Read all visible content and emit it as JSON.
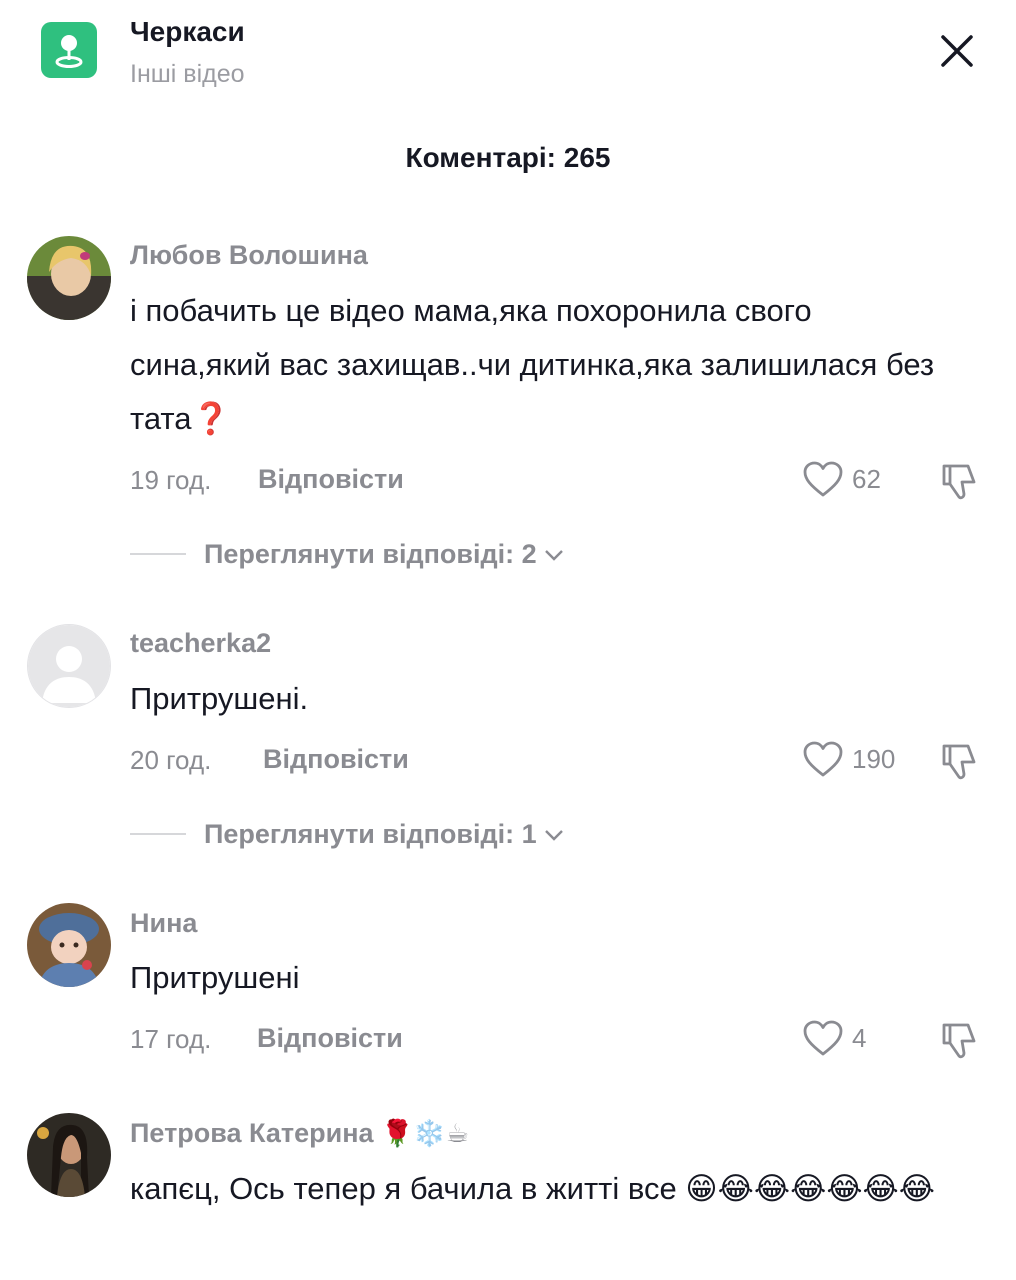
{
  "header": {
    "location_title": "Черкаси",
    "location_subtitle": "Інші відео",
    "location_icon": "location-pin-icon",
    "close_icon": "close-icon"
  },
  "comments_header": "Коментарі: 265",
  "colors": {
    "location_badge": "#2fc07f",
    "muted_text": "#8a8b91",
    "primary_text": "#161823"
  },
  "comments": [
    {
      "username": "Любов Волошина",
      "text": "і побачить це відео мама,яка похоронила свого сина,який вас захищав..чи дитинка,яка залишилася без тата❓",
      "time": "19 год.",
      "reply_label": "Відповісти",
      "likes": "62",
      "view_replies": "Переглянути відповіді: 2"
    },
    {
      "username": "teacherka2",
      "text": "Притрушені.",
      "time": "20 год.",
      "reply_label": "Відповісти",
      "likes": "190",
      "view_replies": "Переглянути відповіді: 1"
    },
    {
      "username": "Нина",
      "text": "Притрушені",
      "time": "17 год.",
      "reply_label": "Відповісти",
      "likes": "4"
    },
    {
      "username": "Петрова Катерина",
      "username_emojis": "🌹❄️☕",
      "text": "капєц, Ось тепер я бачила в житті все 😁😂😂😂😂😂😂"
    }
  ]
}
